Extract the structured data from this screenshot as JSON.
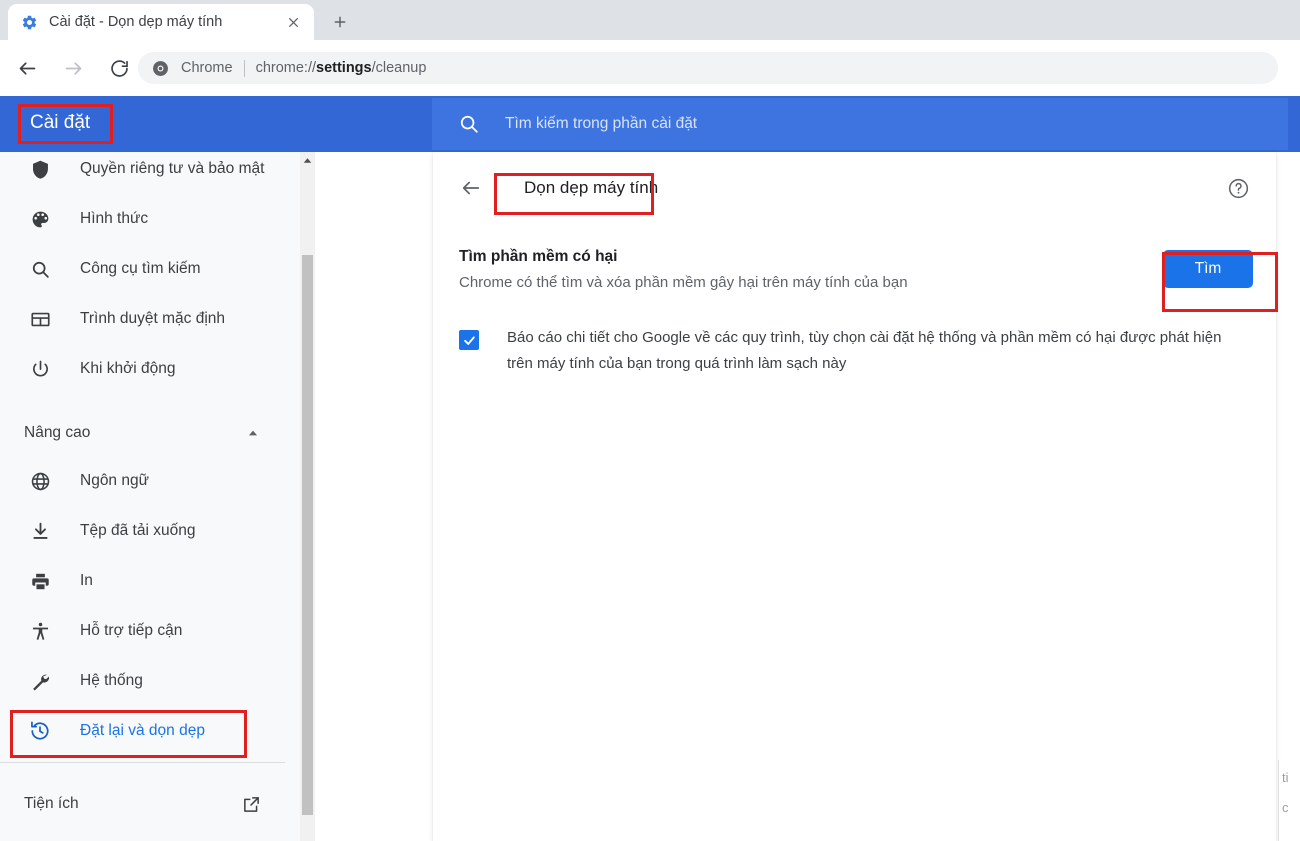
{
  "browser": {
    "tab": {
      "title": "Cài đặt - Dọn dẹp máy tính",
      "favicon": "gear-icon",
      "close": "close-icon"
    },
    "new_tab": "plus-icon",
    "toolbar": {
      "back": "back-arrow-icon",
      "forward": "forward-arrow-icon",
      "reload": "reload-icon"
    },
    "omnibox": {
      "icon": "chrome-logo-icon",
      "scheme_label": "Chrome",
      "url_prefix": "chrome://",
      "url_bold": "settings",
      "url_suffix": "/cleanup",
      "full_url": "chrome://settings/cleanup"
    }
  },
  "settings_header": {
    "title": "Cài đặt",
    "search": {
      "icon": "search-icon",
      "placeholder": "Tìm kiếm trong phần cài đặt",
      "value": ""
    },
    "background_color": "#3367d6",
    "search_background_color": "#3e74e0"
  },
  "sidebar": {
    "items": [
      {
        "label": "Quyền riêng tư và bảo mật",
        "icon": "shield-icon",
        "selected": false
      },
      {
        "label": "Hình thức",
        "icon": "palette-icon",
        "selected": false
      },
      {
        "label": "Công cụ tìm kiếm",
        "icon": "search-icon",
        "selected": false
      },
      {
        "label": "Trình duyệt mặc định",
        "icon": "browser-window-icon",
        "selected": false
      },
      {
        "label": "Khi khởi động",
        "icon": "power-icon",
        "selected": false
      }
    ],
    "section": {
      "label": "Nâng cao",
      "caret": "chevron-up-icon",
      "expanded": true
    },
    "advanced_items": [
      {
        "label": "Ngôn ngữ",
        "icon": "globe-icon",
        "selected": false
      },
      {
        "label": "Tệp đã tải xuống",
        "icon": "download-icon",
        "selected": false
      },
      {
        "label": "In",
        "icon": "printer-icon",
        "selected": false
      },
      {
        "label": "Hỗ trợ tiếp cận",
        "icon": "accessibility-icon",
        "selected": false
      },
      {
        "label": "Hệ thống",
        "icon": "wrench-icon",
        "selected": false
      },
      {
        "label": "Đặt lại và dọn dẹp",
        "icon": "restore-history-icon",
        "selected": true
      }
    ],
    "extensions": {
      "label": "Tiện ích",
      "icon": "open-in-new-icon"
    },
    "scrollbar": {
      "up_arrow": "caret-up-icon"
    }
  },
  "main": {
    "back": "back-arrow-icon",
    "title": "Dọn dẹp máy tính",
    "help": "help-circle-icon",
    "find_section": {
      "title": "Tìm phần mềm có hại",
      "subtitle": "Chrome có thể tìm và xóa phần mềm gây hại trên máy tính của bạn",
      "button_label": "Tìm",
      "button_color": "#1a73e8"
    },
    "report_section": {
      "checkbox_checked": true,
      "checkbox_color": "#1a73e8",
      "text": "Báo cáo chi tiết cho Google về các quy trình, tùy chọn cài đặt hệ thống và phần mềm có hại được phát hiện trên máy tính của bạn trong quá trình làm sạch này"
    }
  },
  "annotations": {
    "color": "#e02020",
    "boxes": [
      {
        "target": "settings-title"
      },
      {
        "target": "sidebar-item-reset-cleanup"
      },
      {
        "target": "page-title"
      },
      {
        "target": "find-button"
      }
    ]
  },
  "background_window": {
    "line1": "ti",
    "line2": "c"
  }
}
